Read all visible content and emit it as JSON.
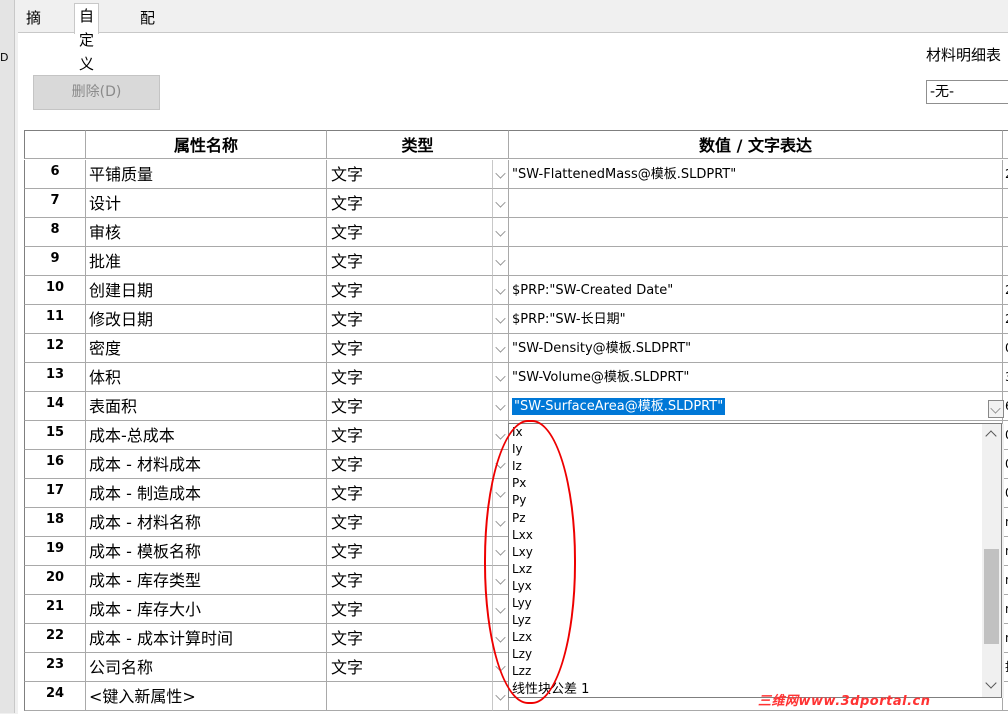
{
  "left_strip": {
    "label": "D"
  },
  "tabs": [
    {
      "label": "摘要",
      "active": false
    },
    {
      "label": "自定义",
      "active": true
    },
    {
      "label": "配置特定",
      "active": false
    }
  ],
  "toolbar": {
    "delete_label": "删除(D)"
  },
  "bom": {
    "label": "材料明细表",
    "selected": "-无-"
  },
  "table": {
    "headers": {
      "name": "属性名称",
      "type": "类型",
      "value": "数值 / 文字表达"
    },
    "rows": [
      {
        "num": "6",
        "name": "平铺质量",
        "type": "文字",
        "value": "\"SW-FlattenedMass@模板.SLDPRT\"",
        "extra": "2"
      },
      {
        "num": "7",
        "name": "设计",
        "type": "文字",
        "value": "",
        "extra": ""
      },
      {
        "num": "8",
        "name": "审核",
        "type": "文字",
        "value": "",
        "extra": ""
      },
      {
        "num": "9",
        "name": "批准",
        "type": "文字",
        "value": "",
        "extra": ""
      },
      {
        "num": "10",
        "name": "创建日期",
        "type": "文字",
        "value": "$PRP:\"SW-Created Date\"",
        "extra": "2"
      },
      {
        "num": "11",
        "name": "修改日期",
        "type": "文字",
        "value": "$PRP:\"SW-长日期\"",
        "extra": "2"
      },
      {
        "num": "12",
        "name": "密度",
        "type": "文字",
        "value": "\"SW-Density@模板.SLDPRT\"",
        "extra": "0"
      },
      {
        "num": "13",
        "name": "体积",
        "type": "文字",
        "value": "\"SW-Volume@模板.SLDPRT\"",
        "extra": "3"
      },
      {
        "num": "14",
        "name": "表面积",
        "type": "文字",
        "value": "\"SW-SurfaceArea@模板.SLDPRT\"",
        "extra": "6"
      },
      {
        "num": "15",
        "name": "成本-总成本",
        "type": "文字",
        "value": "",
        "extra": "0"
      },
      {
        "num": "16",
        "name": "成本 - 材料成本",
        "type": "文字",
        "value": "",
        "extra": "0"
      },
      {
        "num": "17",
        "name": "成本 - 制造成本",
        "type": "文字",
        "value": "",
        "extra": "0"
      },
      {
        "num": "18",
        "name": "成本 - 材料名称",
        "type": "文字",
        "value": "",
        "extra": "n"
      },
      {
        "num": "19",
        "name": "成本 - 模板名称",
        "type": "文字",
        "value": "",
        "extra": "n"
      },
      {
        "num": "20",
        "name": "成本 - 库存类型",
        "type": "文字",
        "value": "",
        "extra": "n"
      },
      {
        "num": "21",
        "name": "成本 - 库存大小",
        "type": "文字",
        "value": "",
        "extra": "n"
      },
      {
        "num": "22",
        "name": "成本 - 成本计算时间",
        "type": "文字",
        "value": "",
        "extra": "n"
      },
      {
        "num": "23",
        "name": "公司名称",
        "type": "文字",
        "value": "",
        "extra": "拓"
      },
      {
        "num": "24",
        "name": "<键入新属性>",
        "type": "",
        "value": "",
        "extra": ""
      }
    ]
  },
  "dropdown": {
    "items": [
      "Ix",
      "Iy",
      "Iz",
      "Px",
      "Py",
      "Pz",
      "Lxx",
      "Lxy",
      "Lxz",
      "Lyx",
      "Lyy",
      "Lyz",
      "Lzx",
      "Lzy",
      "Lzz"
    ],
    "last_item": "线性块公差 1"
  },
  "watermark": {
    "text": "三维网www.3dportal.cn"
  },
  "colors": {
    "selection": "#0078d7",
    "annotation": "#ff0000"
  }
}
